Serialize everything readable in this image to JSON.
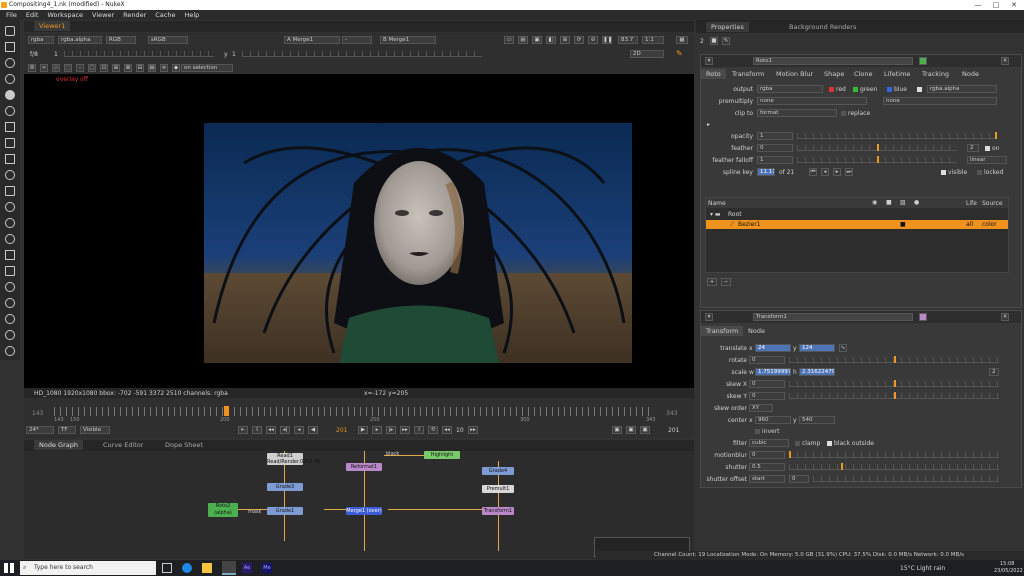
{
  "window": {
    "title": "Compositing4_1.nk (modified) - NukeX",
    "controls": [
      "—",
      "□",
      "✕"
    ]
  },
  "menu": [
    "File",
    "Edit",
    "Workspace",
    "Viewer",
    "Render",
    "Cache",
    "Help"
  ],
  "viewer_tab": "Viewer1",
  "viewer_bar": {
    "channels": "rgba",
    "alpha": "rgba.alpha",
    "rgb": "RGB",
    "colorspace": "sRGB",
    "a_input": "A  Merge1",
    "dash": "-",
    "b_input": "B  Merge1",
    "zoom": "83.7",
    "ratio": "1:1",
    "view_mode": "2D",
    "frame_f": "f/8",
    "frame_val": "1",
    "y_label": "y",
    "y_val": "1",
    "on_selection": "on selection"
  },
  "overlay_text": "overlay off",
  "status": {
    "format": "HD_1080 1920x1080  bbox: -702 -591 3372 2510 channels: rgba",
    "coords": "x=-172 y=205"
  },
  "timeline": {
    "start": "143",
    "end": "343",
    "ticks": [
      "143",
      "150",
      "200",
      "250",
      "300",
      "343"
    ],
    "fps": "24*",
    "tf": "TF",
    "visible": "Visible",
    "frame": "201",
    "step": "10",
    "end_frame": "201"
  },
  "bottom_tabs": [
    "Node Graph",
    "Curve Editor",
    "Dope Sheet"
  ],
  "nodes": {
    "read": "Read1",
    "read_sub": "Read/Render.0201.tif",
    "grade_a": "Grade3",
    "grade_b": "Grade1",
    "roto": "Roto2",
    "roto_sub": "(alpha)",
    "mask": "mask",
    "reformat": "Reformat1",
    "merge": "Merge1 (over)",
    "black": "black",
    "highlight": "Highlight",
    "grade_c": "Grade4",
    "premult": "Premult1",
    "transform_node": "Transform1"
  },
  "right_tabs": [
    "Properties",
    "Background Renders"
  ],
  "roto_panel": {
    "name": "Roto1",
    "tabs": [
      "Roto",
      "Transform",
      "Motion Blur",
      "Shape",
      "Clone",
      "Lifetime",
      "Tracking",
      "Node"
    ],
    "output_label": "output",
    "output": "rgba",
    "red": "red",
    "green": "green",
    "blue": "blue",
    "alpha": "rgba.alpha",
    "premult_label": "premultiply",
    "premult": "none",
    "premult2": "none",
    "clip_label": "clip to",
    "clip": "format",
    "replace": "replace",
    "opacity_label": "opacity",
    "opacity": "1",
    "feather_label": "feather",
    "feather": "0",
    "falloff_label": "feather falloff",
    "falloff": "1",
    "falloff_mode": "linear",
    "on": "on",
    "count": "2",
    "splinekey_label": "spline key",
    "splinekey": "11.11",
    "of": "of 21",
    "visible": "visible",
    "locked": "locked",
    "cols": {
      "name": "Name",
      "life": "Life",
      "source": "Source"
    },
    "root": "Root",
    "bezier": "Bezier1",
    "all": "all",
    "color": "color"
  },
  "transform_panel": {
    "name": "Transform1",
    "tabs": [
      "Transform",
      "Node"
    ],
    "translate_label": "translate",
    "tx_l": "x",
    "tx": "24",
    "ty_l": "y",
    "ty": "124",
    "rotate_label": "rotate",
    "rotate": "0",
    "scale_label": "scale",
    "sw_l": "w",
    "sw": "1.75199997",
    "sh_l": "h",
    "sh": "2.31622479",
    "scale_n": "2",
    "skewx_label": "skew X",
    "skewx": "0",
    "skewy_label": "skew Y",
    "skewy": "0",
    "skeworder_label": "skew order",
    "skeworder": "XY",
    "center_label": "center",
    "cx_l": "x",
    "cx": "960",
    "cy_l": "y",
    "cy": "540",
    "invert": "invert",
    "filter_label": "filter",
    "filter": "cubic",
    "clamp": "clamp",
    "black_outside": "black outside",
    "mb_label": "motionblur",
    "mb": "0",
    "shutter_label": "shutter",
    "shutter": "0.5",
    "shutter_off_label": "shutter offset",
    "shutter_off": "start",
    "shutter_off_v": "0"
  },
  "statusbar": "Channel Count: 19  Localization Mode: On  Memory: 5.0 GB (31.9%)  CPU: 37.5%  Disk: 0.0 MB/s  Network: 0.0 MB/s",
  "taskbar": {
    "search": "Type here to search",
    "weather": "15°C  Light rain",
    "time": "15:08",
    "date": "23/05/2022"
  },
  "colors": {
    "accent": "#f0921e",
    "roto": "#4caf50",
    "grade": "#6d8fc9",
    "merge": "#3c5bd6"
  }
}
